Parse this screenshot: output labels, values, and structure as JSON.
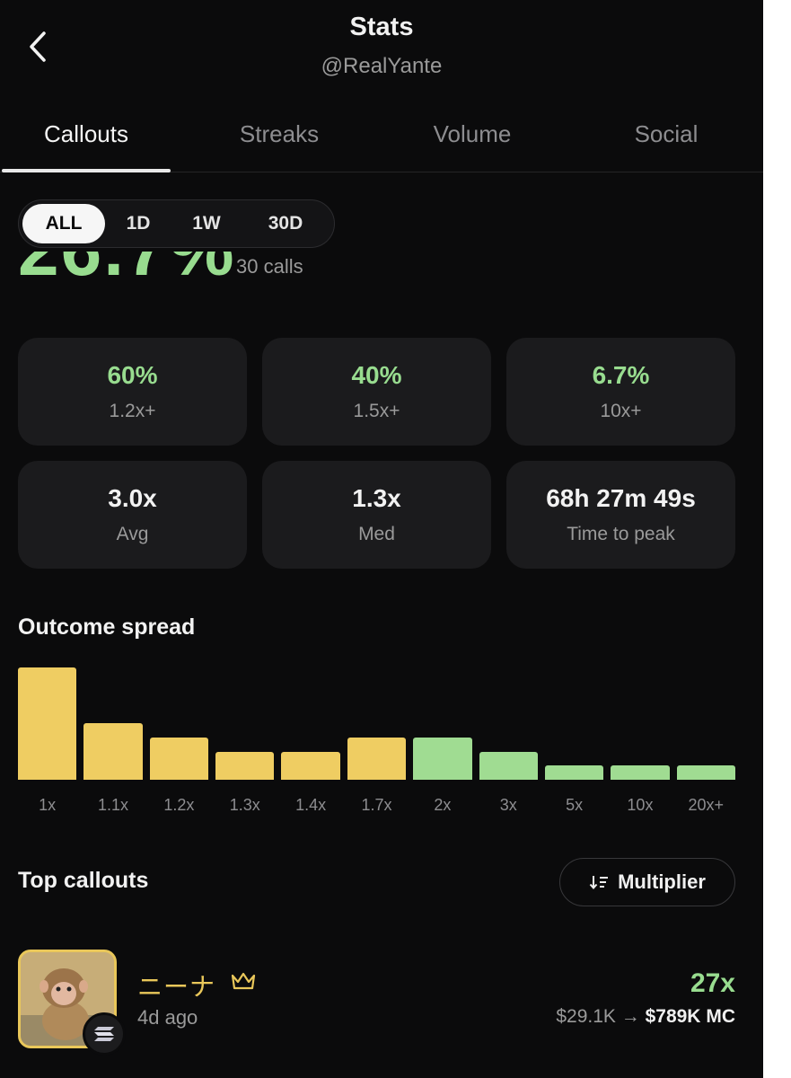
{
  "header": {
    "title": "Stats",
    "handle": "@RealYante"
  },
  "tabs": [
    {
      "label": "Callouts",
      "active": true
    },
    {
      "label": "Streaks",
      "active": false
    },
    {
      "label": "Volume",
      "active": false
    },
    {
      "label": "Social",
      "active": false
    }
  ],
  "period_filter": {
    "options": [
      "ALL",
      "1D",
      "1W",
      "30D"
    ],
    "selected": "ALL"
  },
  "summary": {
    "headline_value": "26.7%",
    "calls_label": "30 calls"
  },
  "stats": [
    {
      "value": "60%",
      "label": "1.2x+",
      "color": "green"
    },
    {
      "value": "40%",
      "label": "1.5x+",
      "color": "green"
    },
    {
      "value": "6.7%",
      "label": "10x+",
      "color": "green"
    },
    {
      "value": "3.0x",
      "label": "Avg",
      "color": "white"
    },
    {
      "value": "1.3x",
      "label": "Med",
      "color": "white"
    },
    {
      "value": "68h 27m 49s",
      "label": "Time to peak",
      "color": "white"
    }
  ],
  "outcome_spread": {
    "title": "Outcome spread"
  },
  "chart_data": {
    "type": "bar",
    "categories": [
      "1x",
      "1.1x",
      "1.2x",
      "1.3x",
      "1.4x",
      "1.7x",
      "2x",
      "3x",
      "5x",
      "10x",
      "20x+"
    ],
    "values": [
      8,
      4,
      3,
      2,
      2,
      3,
      3,
      2,
      1,
      1,
      1
    ],
    "colors": [
      "#efcd62",
      "#efcd62",
      "#efcd62",
      "#efcd62",
      "#efcd62",
      "#efcd62",
      "#a0dc92",
      "#a0dc92",
      "#a0dc92",
      "#a0dc92",
      "#a0dc92"
    ],
    "title": "Outcome spread",
    "xlabel": "",
    "ylabel": "",
    "ylim": [
      0,
      8
    ],
    "grid": false
  },
  "top_callouts": {
    "title": "Top callouts",
    "sort_label": "Multiplier",
    "items": [
      {
        "name": "ニーナ",
        "time_ago": "4d ago",
        "multiplier": "27x",
        "mc_from": "$29.1K",
        "arrow": "→",
        "mc_to": "$789K",
        "mc_unit": "MC"
      }
    ]
  },
  "colors": {
    "background": "#0b0b0c",
    "card": "#1b1b1d",
    "green": "#98dc8f",
    "yellow": "#efcd62",
    "muted": "#9a9a9a"
  }
}
